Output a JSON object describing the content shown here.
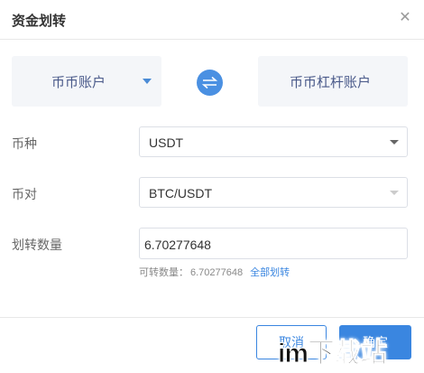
{
  "dialog": {
    "title": "资金划转",
    "close_icon": "close-icon"
  },
  "transfer": {
    "from_account": "币币账户",
    "to_account": "币币杠杆账户",
    "swap_icon": "swap-arrows-icon",
    "accent_color": "#4a90e2"
  },
  "form": {
    "currency_label": "币种",
    "currency_value": "USDT",
    "pair_label": "币对",
    "pair_value": "BTC/USDT",
    "amount_label": "划转数量",
    "amount_value": "6.70277648",
    "available_label": "可转数量：",
    "available_value": "6.70277648",
    "transfer_all": "全部划转"
  },
  "footer": {
    "cancel": "取消",
    "confirm": "确定"
  },
  "watermark": {
    "text": "im下载站"
  }
}
